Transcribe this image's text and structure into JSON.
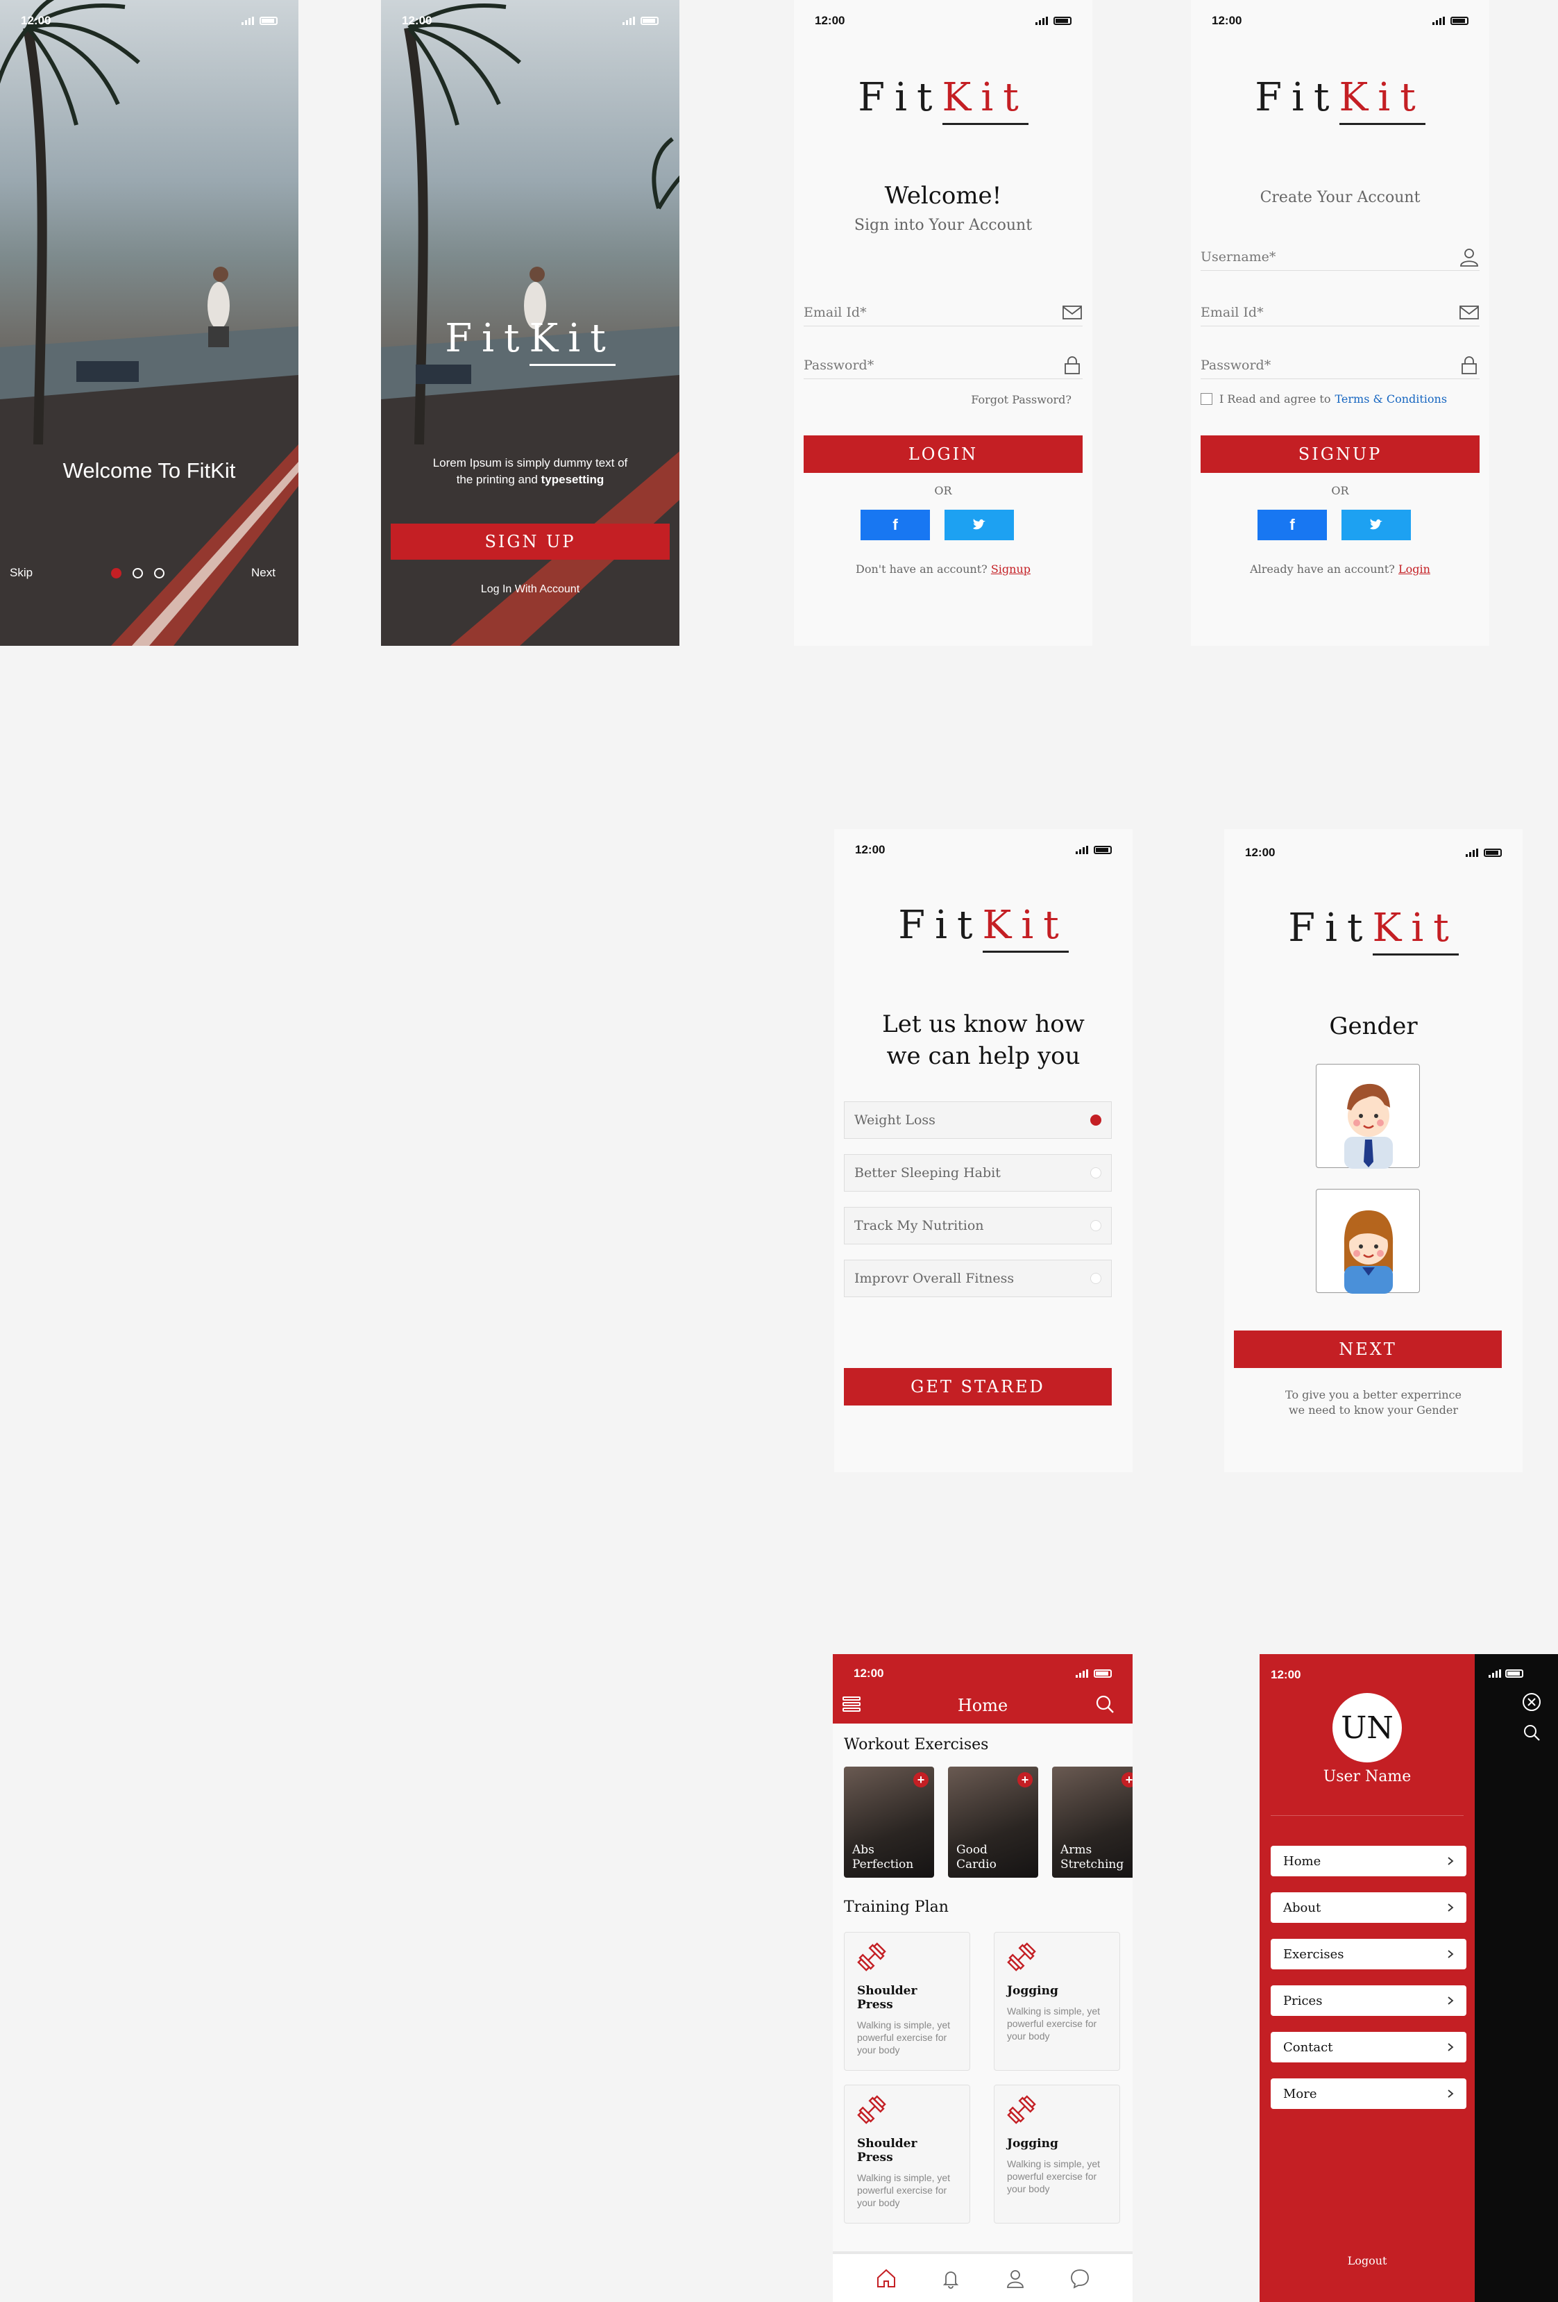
{
  "status": {
    "time": "12:00"
  },
  "brand": {
    "fit": "Fit",
    "kit": "Kit"
  },
  "welcome1": {
    "title": "Welcome To FitKit",
    "skip": "Skip",
    "next": "Next"
  },
  "welcome2": {
    "lorem": "Lorem Ipsum is simply dummy text of the printing and",
    "lorem_bold": "typesetting",
    "signup": "SIGN UP",
    "login_link": "Log In With Account"
  },
  "login": {
    "title": "Welcome!",
    "subtitle": "Sign into Your Account",
    "email_placeholder": "Email Id*",
    "password_placeholder": "Password*",
    "forgot": "Forgot Password?",
    "button": "LOGIN",
    "or": "OR",
    "no_account": "Don't have an account?",
    "signup_link": "Signup"
  },
  "signup": {
    "title": "Create Your Account",
    "username_placeholder": "Username*",
    "email_placeholder": "Email Id*",
    "password_placeholder": "Password*",
    "agree": "I Read and agree to",
    "terms": "Terms & Conditions",
    "button": "SIGNUP",
    "or": "OR",
    "have_account": "Already have an account?",
    "login_link": "Login"
  },
  "goals": {
    "title_line1": "Let us know how",
    "title_line2": "we can help you",
    "options": [
      "Weight Loss",
      "Better Sleeping Habit",
      "Track My Nutrition",
      "Improvr Overall Fitness"
    ],
    "selected": 0,
    "button": "GET STARED"
  },
  "gender": {
    "title": "Gender",
    "button": "NEXT",
    "note_line1": "To give you a better experrince",
    "note_line2": "we need to know your Gender"
  },
  "home": {
    "header_title": "Home",
    "workout_title": "Workout Exercises",
    "workouts": [
      {
        "line1": "Abs",
        "line2": "Perfection"
      },
      {
        "line1": "Good",
        "line2": "Cardio"
      },
      {
        "line1": "Arms",
        "line2": "Stretching"
      }
    ],
    "plan_title": "Training Plan",
    "plans": [
      {
        "title": "Shoulder Press",
        "desc": "Walking is simple, yet powerful exercise for your body"
      },
      {
        "title": "Jogging",
        "desc": "Walking is simple, yet powerful exercise for your body"
      },
      {
        "title": "Shoulder Press",
        "desc": "Walking is simple, yet powerful exercise for your body"
      },
      {
        "title": "Jogging",
        "desc": "Walking is simple, yet powerful exercise for your body"
      }
    ],
    "tabs": [
      "home-icon",
      "bell-icon",
      "user-icon",
      "chat-icon"
    ]
  },
  "drawer": {
    "initials": "UN",
    "username": "User Name",
    "items": [
      "Home",
      "About",
      "Exercises",
      "Prices",
      "Contact",
      "More"
    ],
    "logout": "Logout"
  },
  "colors": {
    "brand_red": "#c41f24",
    "facebook": "#1877f2",
    "twitter": "#1da1f2"
  }
}
